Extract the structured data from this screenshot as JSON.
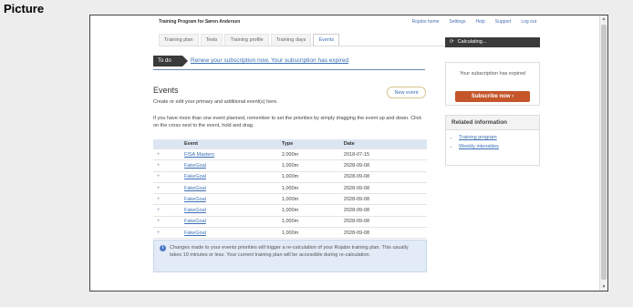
{
  "caption": "Picture",
  "app": {
    "title": "Training Program for Søren Andersen",
    "links": [
      "Rojabo home",
      "Settings",
      "Help",
      "Support",
      "Log out"
    ]
  },
  "tabs": [
    "Training plan",
    "Tests",
    "Training profile",
    "Training days",
    "Events"
  ],
  "active_tab": "Events",
  "todo": {
    "badge": "To do",
    "link": "Renew your subscription now. Your subscription has expired"
  },
  "events": {
    "title": "Events",
    "new_button": "New event",
    "subtitle": "Create or edit your primary and additional event(s) here.",
    "note": "If you have more than one event planned, remember to set the priorities by simply dragging the event up and down. Click on the cross next to the event, hold and drag.",
    "columns": [
      "Event",
      "Type",
      "Date"
    ],
    "rows": [
      {
        "event": "FISA Masters",
        "type": "2,000m",
        "date": "2018-07-15"
      },
      {
        "event": "FakeGoal",
        "type": "1,000m",
        "date": "2028-09-08"
      },
      {
        "event": "FakeGoal",
        "type": "1,000m",
        "date": "2028-09-08"
      },
      {
        "event": "FakeGoal",
        "type": "1,000m",
        "date": "2028-09-08"
      },
      {
        "event": "FakeGoal",
        "type": "1,000m",
        "date": "2028-09-08"
      },
      {
        "event": "FakeGoal",
        "type": "1,000m",
        "date": "2028-09-08"
      },
      {
        "event": "FakeGoal",
        "type": "1,000m",
        "date": "2028-09-08"
      },
      {
        "event": "FakeGoal",
        "type": "1,000m",
        "date": "2028-09-08"
      }
    ],
    "info": "Changes made to your events priorities will trigger a re-calculation of your Rojabo training plan. This usually takes 10 minutes or less. Your current training plan will be accessible during re-calculation."
  },
  "sidebar": {
    "status": "Calculating...",
    "subscription_text": "Your subscription has expired",
    "subscribe_button": "Subscribe now",
    "related_title": "Related information",
    "related_links": [
      "Training program",
      "Weekly intensities"
    ]
  },
  "colors": {
    "accent": "#3a6fb5",
    "subscribe": "#c4562a",
    "dark_bar": "#3a3a3a"
  }
}
